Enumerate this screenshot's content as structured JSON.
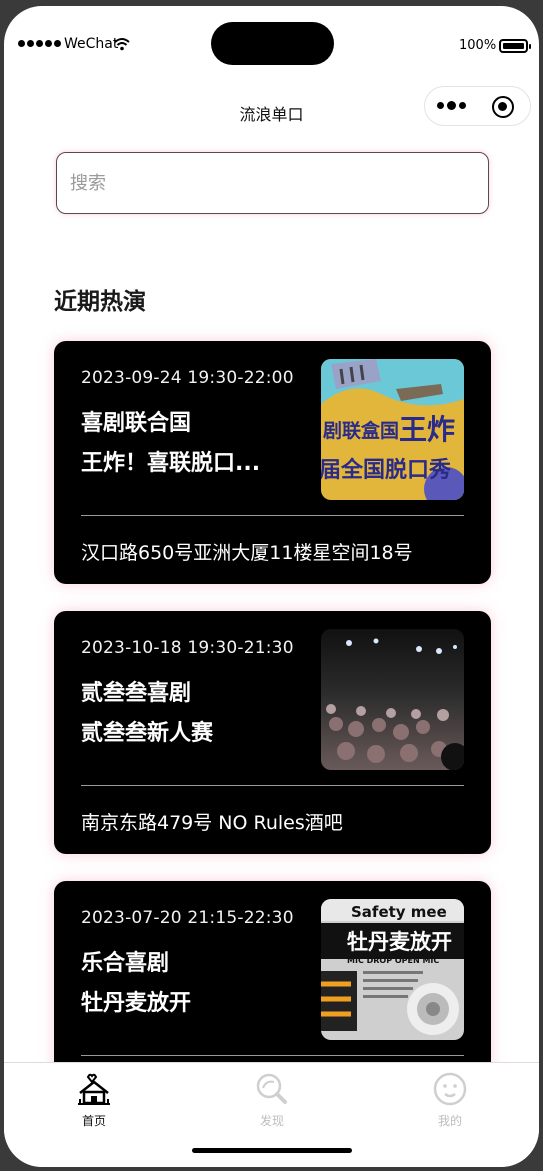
{
  "status_bar": {
    "carrier": "WeChat",
    "battery": "100%"
  },
  "nav": {
    "title": "流浪单口"
  },
  "search": {
    "placeholder": "搜索"
  },
  "section": {
    "title": "近期热演"
  },
  "cards": [
    {
      "time": "2023-09-24 19:30-22:00",
      "troupe": "喜剧联合国",
      "show": "王炸！喜联脱口...",
      "address": "汉口路650号亚洲大厦11楼星空间18号",
      "image_text": [
        "剧联盒国",
        "王炸",
        "届全国脱口秀"
      ]
    },
    {
      "time": "2023-10-18 19:30-21:30",
      "troupe": "贰叁叁喜剧",
      "show": "贰叁叁新人赛",
      "address": "南京东路479号 NO Rules酒吧"
    },
    {
      "time": "2023-07-20 21:15-22:30",
      "troupe": "乐合喜剧",
      "show": "牡丹麦放开",
      "address": "",
      "image_text": [
        "Safety mee",
        "牡丹麦放开",
        "MIC DROP OPEN MIC"
      ]
    }
  ],
  "tabbar": {
    "items": [
      {
        "label": "首页",
        "icon": "home-icon",
        "active": true
      },
      {
        "label": "发现",
        "icon": "discover-icon",
        "active": false
      },
      {
        "label": "我的",
        "icon": "profile-icon",
        "active": false
      }
    ]
  },
  "colors": {
    "card_bg": "#000000",
    "card_glow": "#f07896",
    "inactive_tab": "#bdbdbd"
  }
}
